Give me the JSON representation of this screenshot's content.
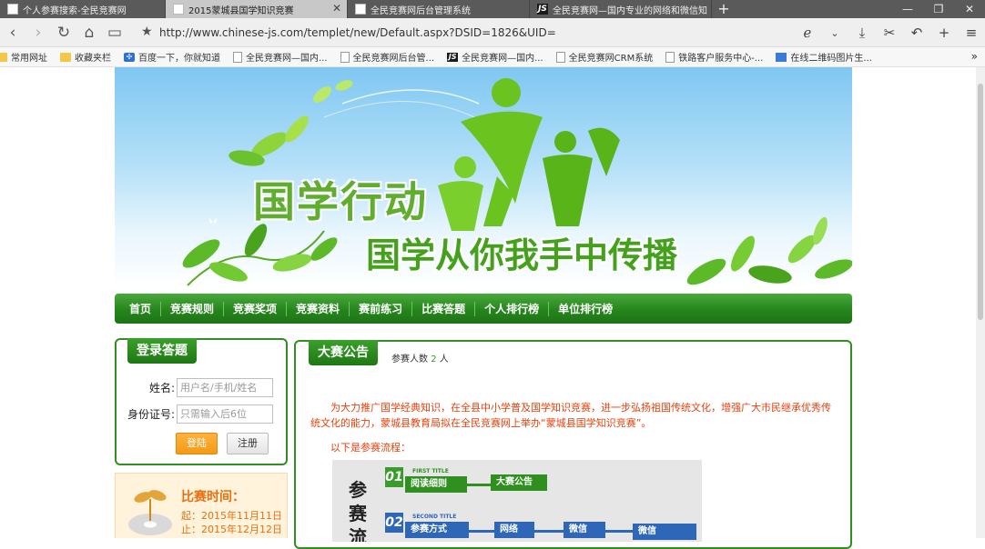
{
  "browser": {
    "tabs": [
      {
        "title": "个人参赛搜索-全民竞赛网",
        "active": false
      },
      {
        "title": "2015蒙城县国学知识竞赛",
        "active": true
      },
      {
        "title": "全民竞赛网后台管理系统",
        "active": false
      },
      {
        "title": "全民竞赛网—国内专业的网络和微信知",
        "active": false
      }
    ],
    "url": "http://www.chinese-js.com/templet/new/Default.aspx?DSID=1826&UID=",
    "bookmarks": [
      {
        "label": "常用网址",
        "icon": "folder-icon"
      },
      {
        "label": "收藏夹栏",
        "icon": "folder-icon"
      },
      {
        "label": "百度一下，你就知道",
        "icon": "paw-icon"
      },
      {
        "label": "全民竞赛网—国内...",
        "icon": "page-icon"
      },
      {
        "label": "全民竞赛网后台管...",
        "icon": "page-icon"
      },
      {
        "label": "全民竞赛网—国内...",
        "icon": "js-icon"
      },
      {
        "label": "全民竞赛网CRM系统",
        "icon": "page-icon"
      },
      {
        "label": "铁路客户服务中心-...",
        "icon": "page-icon"
      },
      {
        "label": "在线二维码图片生...",
        "icon": "qr-icon"
      }
    ]
  },
  "banner": {
    "title": "国学行动",
    "slogan": "国学从你我手中传播"
  },
  "nav": {
    "items": [
      "首页",
      "竞赛规则",
      "竞赛奖项",
      "竞赛资料",
      "赛前练习",
      "比赛答题",
      "个人排行榜",
      "单位排行榜"
    ]
  },
  "login": {
    "title": "登录答题",
    "name_label": "姓名:",
    "name_placeholder": "用户名/手机/姓名",
    "id_label": "身份证号:",
    "id_placeholder": "只需输入后6位",
    "login_button": "登陆",
    "register_button": "注册"
  },
  "match_time": {
    "title": "比赛时间：",
    "start": "起：2015年11月11日",
    "end": "止：2015年12月12日"
  },
  "notice": {
    "title": "大赛公告",
    "count_prefix": "参赛人数",
    "count_value": "2",
    "count_suffix": "人",
    "paragraph": "为大力推广国学经典知识，在全县中小学普及国学知识竞赛，进一步弘扬祖国传统文化，增强广大市民继承优秀传统文化的能力，蒙城县教育局拟在全民竞赛网上举办“蒙城县国学知识竞赛”。",
    "sub": "以下是参赛流程：",
    "flow": {
      "vertical_title": "参赛流",
      "step1_num": "01",
      "step1_caption": "FIRST TITLE",
      "step1_label": "阅读细则",
      "step1_next": "大赛公告",
      "step2_num": "02",
      "step2_caption": "SECOND TITLE",
      "step2_label": "参赛方式",
      "step2_opt1": "网络",
      "step2_opt2": "微信",
      "step2_opt3": "微信"
    }
  },
  "colors": {
    "nav_green": "#26851c",
    "border_green": "#2f8f1f",
    "notice_red": "#e8400d",
    "time_orange": "#e8700f",
    "login_orange": "#f39a14"
  }
}
